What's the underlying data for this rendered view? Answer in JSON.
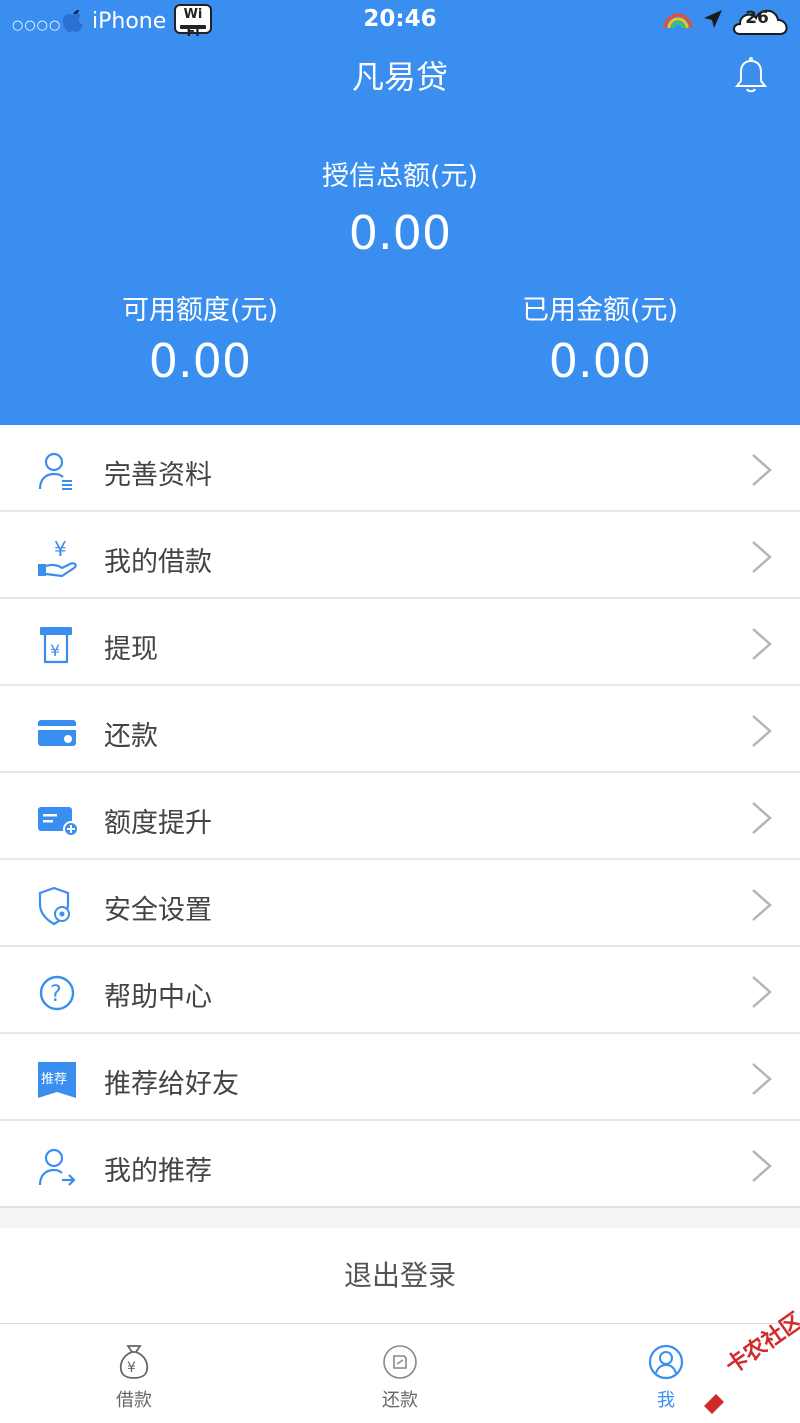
{
  "status_bar": {
    "signal": "○○○○",
    "carrier": "iPhone",
    "wifi": "Wi Fi",
    "time": "20:46",
    "temperature": "26"
  },
  "header": {
    "title": "凡易贷",
    "total_label": "授信总额(元)",
    "total_value": "0.00",
    "available_label": "可用额度(元)",
    "available_value": "0.00",
    "used_label": "已用金额(元)",
    "used_value": "0.00"
  },
  "menu": {
    "items": [
      {
        "label": "完善资料",
        "icon": "user-profile-icon"
      },
      {
        "label": "我的借款",
        "icon": "hand-yuan-icon"
      },
      {
        "label": "提现",
        "icon": "withdraw-yuan-icon"
      },
      {
        "label": "还款",
        "icon": "card-icon"
      },
      {
        "label": "额度提升",
        "icon": "card-plus-icon"
      },
      {
        "label": "安全设置",
        "icon": "shield-gear-icon"
      },
      {
        "label": "帮助中心",
        "icon": "help-icon"
      },
      {
        "label": "推荐给好友",
        "icon": "recommend-badge-icon",
        "badge": "推荐"
      },
      {
        "label": "我的推荐",
        "icon": "user-arrow-icon"
      }
    ]
  },
  "logout_label": "退出登录",
  "tabs": [
    {
      "label": "借款",
      "icon": "money-bag-icon"
    },
    {
      "label": "还款",
      "icon": "repay-icon"
    },
    {
      "label": "我",
      "icon": "user-circle-icon",
      "active": true
    }
  ],
  "watermark": "卡农社区",
  "colors": {
    "primary": "#3a8ef0",
    "background": "#f3f4f6",
    "text": "#444444",
    "chevron": "#b5b5b5"
  }
}
